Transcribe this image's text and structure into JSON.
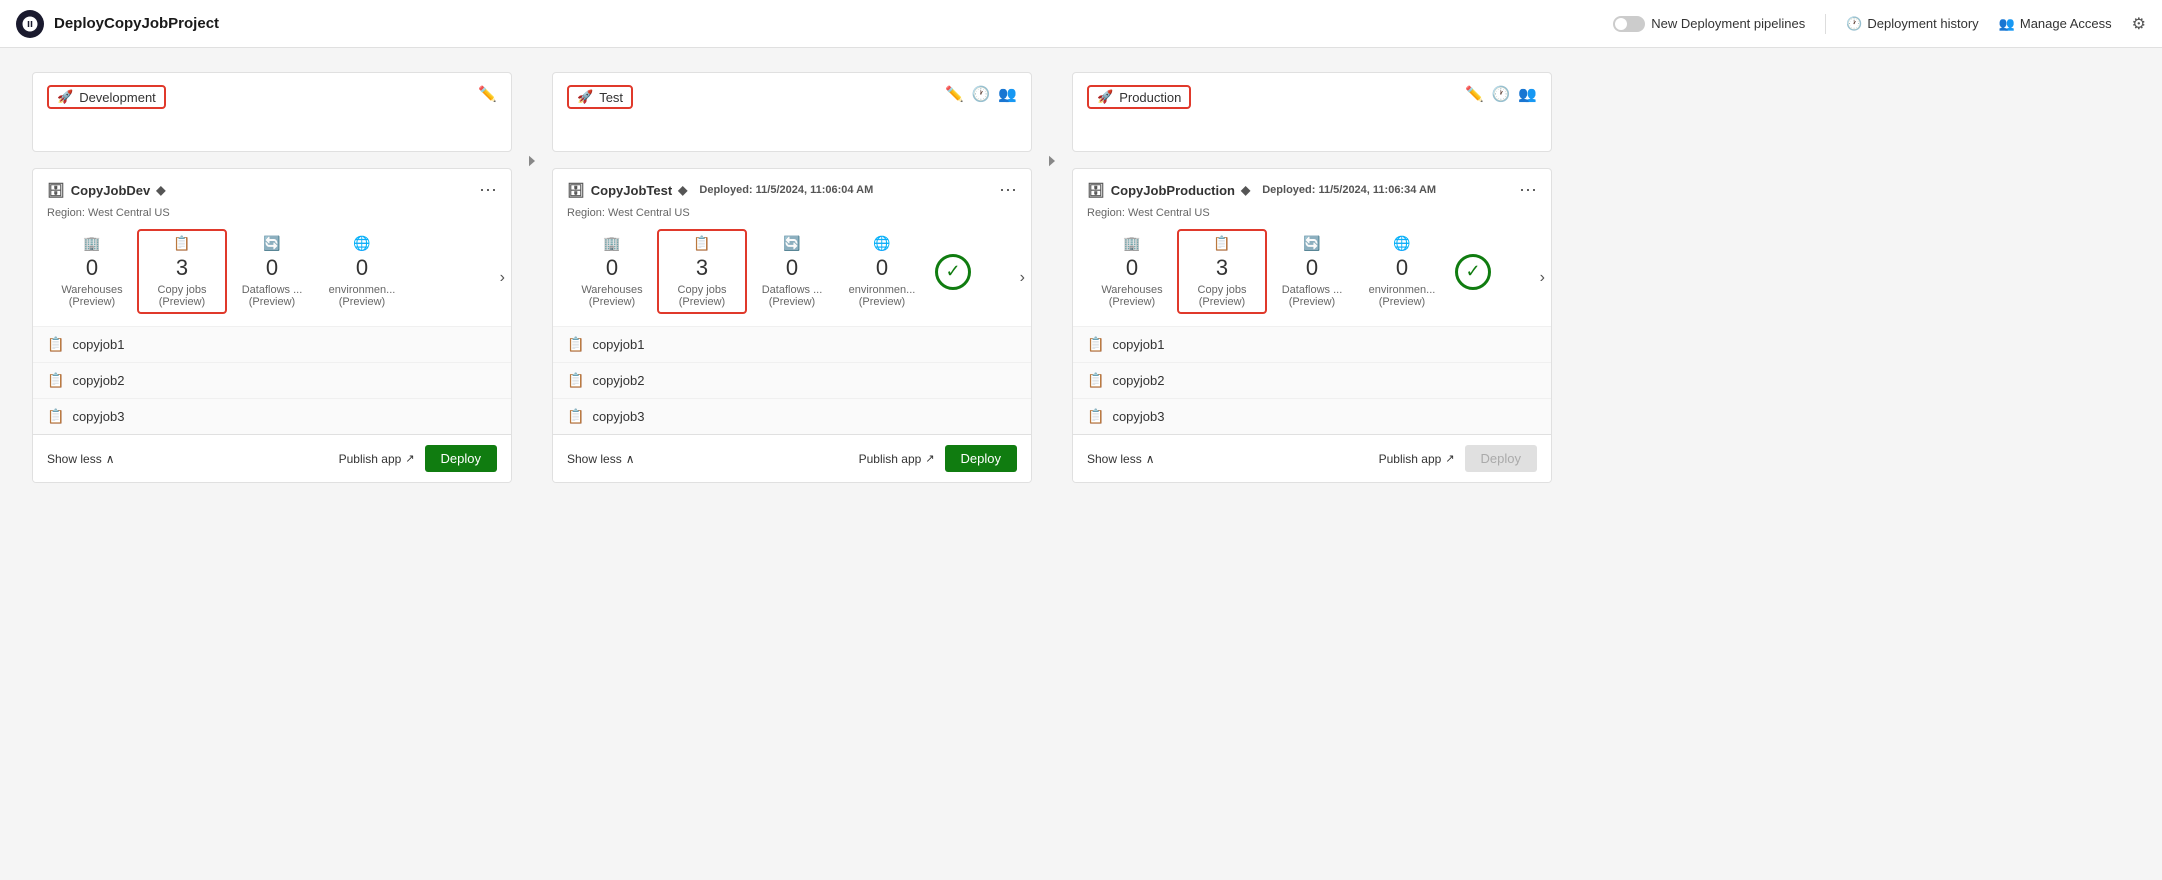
{
  "header": {
    "title": "DeployCopyJobProject",
    "logo_icon": "rocket-icon",
    "toggle_label": "New Deployment pipelines",
    "deployment_history_label": "Deployment history",
    "manage_access_label": "Manage Access",
    "gear_icon": "gear-icon"
  },
  "stages": [
    {
      "id": "development",
      "label": "Development",
      "outlined": true,
      "header_actions": [
        "edit"
      ],
      "card": {
        "title": "CopyJobDev",
        "has_diamond": true,
        "deployed": null,
        "region": "Region: West Central US",
        "stats": [
          {
            "icon": "warehouse",
            "count": "0",
            "label": "Warehouses\n(Preview)",
            "highlighted": false
          },
          {
            "icon": "copy",
            "count": "3",
            "label": "Copy jobs\n(Preview)",
            "highlighted": true
          },
          {
            "icon": "dataflow",
            "count": "0",
            "label": "Dataflows ...\n(Preview)",
            "highlighted": false
          },
          {
            "icon": "environment",
            "count": "0",
            "label": "environmen...\n(Preview)",
            "highlighted": false
          }
        ],
        "has_success": false,
        "items": [
          "copyjob1",
          "copyjob2",
          "copyjob3"
        ],
        "show_less": "Show less",
        "publish_label": "Publish app",
        "deploy_label": "Deploy",
        "deploy_disabled": false
      }
    },
    {
      "id": "test",
      "label": "Test",
      "outlined": true,
      "header_actions": [
        "edit",
        "history",
        "users"
      ],
      "card": {
        "title": "CopyJobTest",
        "has_diamond": true,
        "deployed": "Deployed: 11/5/2024, 11:06:04 AM",
        "region": "Region: West Central US",
        "stats": [
          {
            "icon": "warehouse",
            "count": "0",
            "label": "Warehouses\n(Preview)",
            "highlighted": false
          },
          {
            "icon": "copy",
            "count": "3",
            "label": "Copy jobs\n(Preview)",
            "highlighted": true
          },
          {
            "icon": "dataflow",
            "count": "0",
            "label": "Dataflows ...\n(Preview)",
            "highlighted": false
          },
          {
            "icon": "environment",
            "count": "0",
            "label": "environmen...\n(Preview)",
            "highlighted": false
          }
        ],
        "has_success": true,
        "items": [
          "copyjob1",
          "copyjob2",
          "copyjob3"
        ],
        "show_less": "Show less",
        "publish_label": "Publish app",
        "deploy_label": "Deploy",
        "deploy_disabled": false
      }
    },
    {
      "id": "production",
      "label": "Production",
      "outlined": true,
      "header_actions": [
        "edit",
        "history",
        "users"
      ],
      "card": {
        "title": "CopyJobProduction",
        "has_diamond": true,
        "deployed": "Deployed: 11/5/2024, 11:06:34 AM",
        "region": "Region: West Central US",
        "stats": [
          {
            "icon": "warehouse",
            "count": "0",
            "label": "Warehouses\n(Preview)",
            "highlighted": false
          },
          {
            "icon": "copy",
            "count": "3",
            "label": "Copy jobs\n(Preview)",
            "highlighted": true
          },
          {
            "icon": "dataflow",
            "count": "0",
            "label": "Dataflows ...\n(Preview)",
            "highlighted": false
          },
          {
            "icon": "environment",
            "count": "0",
            "label": "environmen...\n(Preview)",
            "highlighted": false
          }
        ],
        "has_success": true,
        "items": [
          "copyjob1",
          "copyjob2",
          "copyjob3"
        ],
        "show_less": "Show less",
        "publish_label": "Publish app",
        "deploy_label": "Deploy",
        "deploy_disabled": true
      }
    }
  ]
}
